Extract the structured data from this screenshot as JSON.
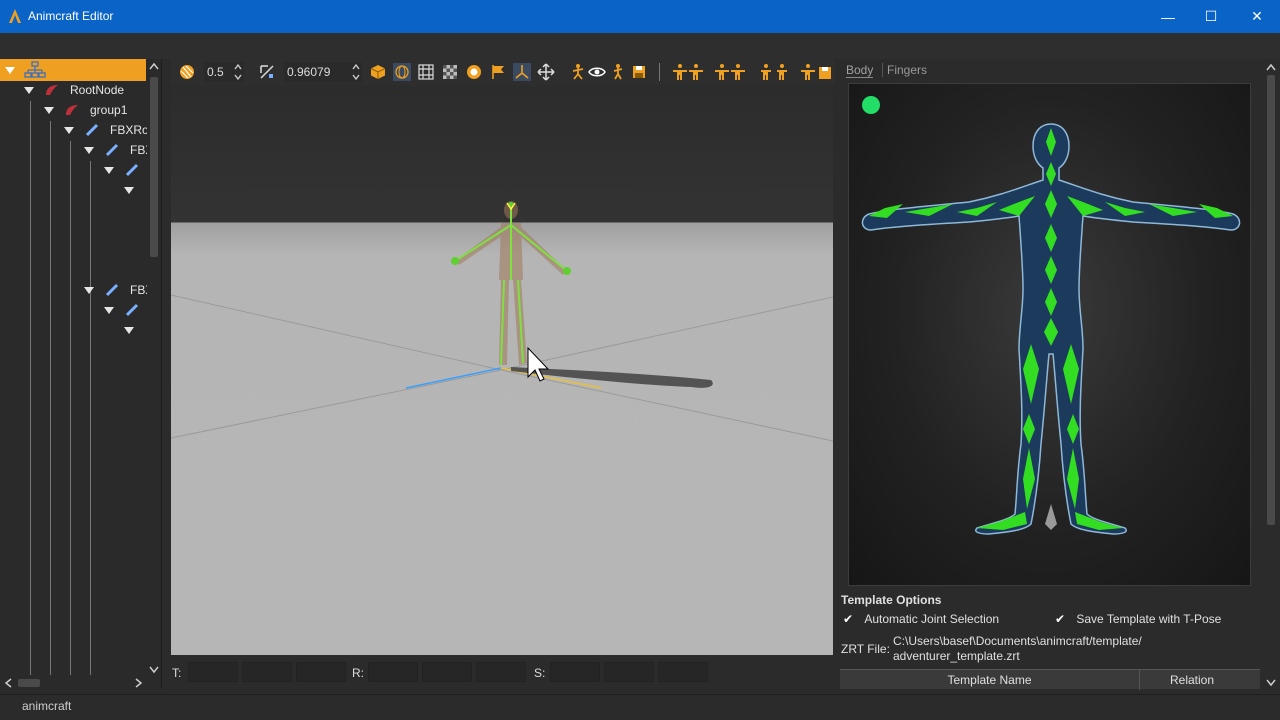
{
  "window": {
    "title": "Animcraft Editor",
    "minimize_glyph": "—",
    "maximize_glyph": "☐",
    "close_glyph": "✕"
  },
  "tree": {
    "rows": [
      {
        "label": "RootNode"
      },
      {
        "label": "group1"
      },
      {
        "label": "FBXRoo"
      },
      {
        "label": "FBX"
      },
      {
        "label": ""
      },
      {
        "label": ""
      },
      {
        "label": "FBX"
      },
      {
        "label": ""
      },
      {
        "label": ""
      }
    ]
  },
  "toolbar": {
    "value1": "0.5",
    "value2": "0.96079"
  },
  "transform": {
    "t_label": "T:",
    "r_label": "R:",
    "s_label": "S:"
  },
  "right_panel": {
    "tabs": [
      {
        "label": "Body"
      },
      {
        "label": "Fingers"
      }
    ],
    "template_options_title": "Template Options",
    "auto_joint_label": "Automatic Joint Selection",
    "save_tpose_label": "Save Template with T-Pose",
    "check_glyph": "✔",
    "zrt_label": "ZRT File:",
    "zrt_path_line1": "C:\\Users\\basef\\Documents\\animcraft/template/",
    "zrt_path_line2": "adventurer_template.zrt",
    "table_headers": {
      "name": "Template Name",
      "relation": "Relation"
    }
  },
  "status": {
    "text": "animcraft"
  },
  "colors": {
    "titlebar": "#0a64c8",
    "accent_orange": "#f0a020",
    "joint_green": "#33dd22",
    "body_fill": "#1c3b5c"
  }
}
